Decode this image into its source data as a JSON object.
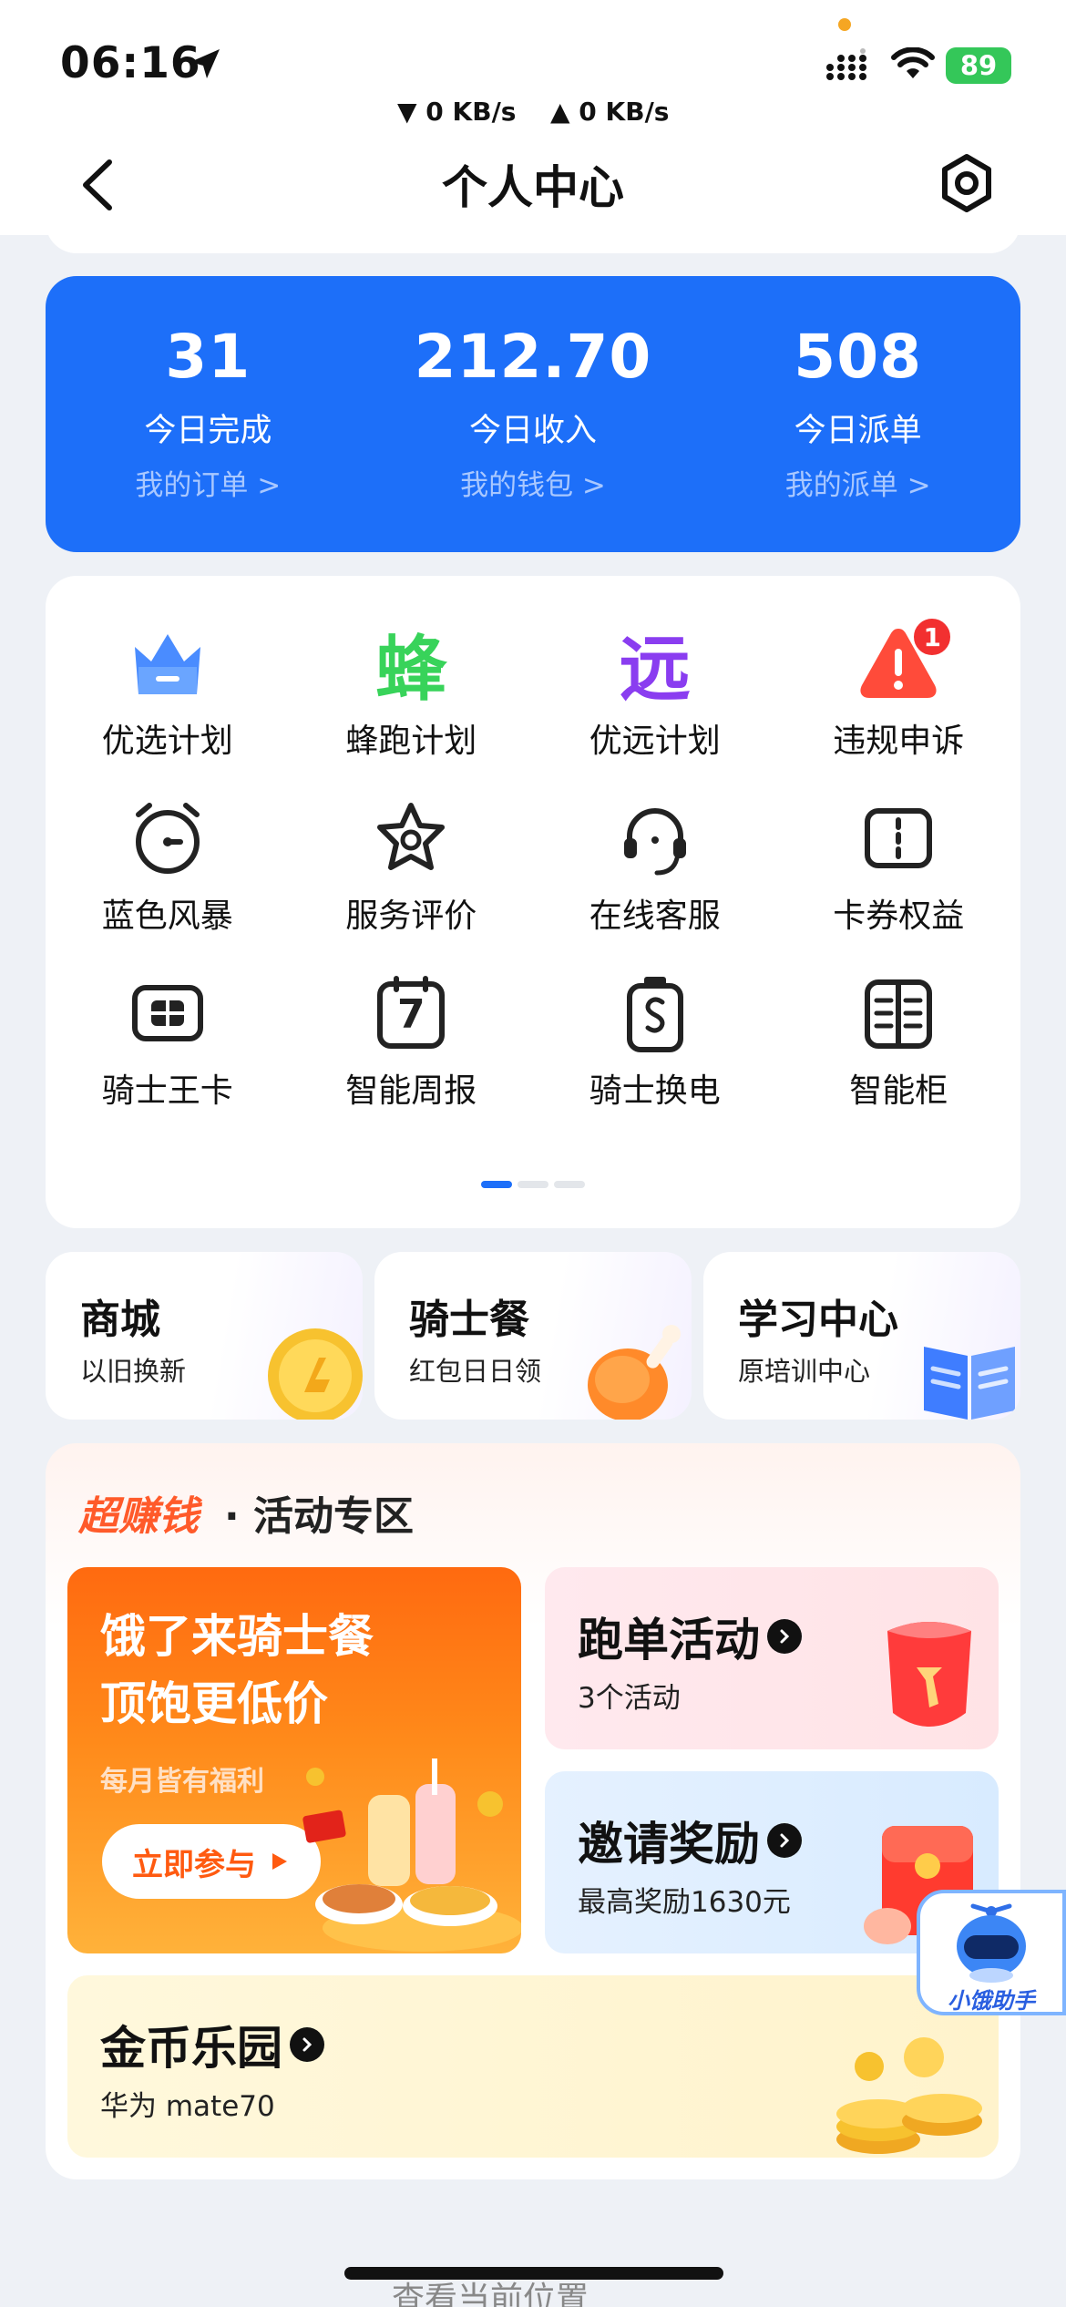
{
  "status_bar": {
    "time": "06:16",
    "battery": "89",
    "download": "0 KB/s",
    "upload": "0 KB/s",
    "download_arrow": "▼",
    "upload_arrow": "▲"
  },
  "header": {
    "title": "个人中心",
    "back_icon": "chevron-left-icon",
    "settings_icon": "gear-icon"
  },
  "stats": [
    {
      "value": "31",
      "label": "今日完成",
      "link": "我的订单 >"
    },
    {
      "value": "212.70",
      "label": "今日收入",
      "link": "我的钱包 >"
    },
    {
      "value": "508",
      "label": "今日派单",
      "link": "我的派单 >"
    }
  ],
  "services": [
    {
      "label": "优选计划",
      "icon": "crown-icon"
    },
    {
      "label": "蜂跑计划",
      "icon": "bee-run-icon",
      "glyph": "蜂"
    },
    {
      "label": "优远计划",
      "icon": "far-plan-icon",
      "glyph": "远"
    },
    {
      "label": "违规申诉",
      "icon": "alert-icon",
      "badge": "1"
    },
    {
      "label": "蓝色风暴",
      "icon": "alarm-clock-icon"
    },
    {
      "label": "服务评价",
      "icon": "star-badge-icon"
    },
    {
      "label": "在线客服",
      "icon": "headset-icon"
    },
    {
      "label": "卡券权益",
      "icon": "coupon-icon"
    },
    {
      "label": "骑士王卡",
      "icon": "card-icon"
    },
    {
      "label": "智能周报",
      "icon": "calendar-icon",
      "glyph": "7"
    },
    {
      "label": "骑士换电",
      "icon": "battery-swap-icon"
    },
    {
      "label": "智能柜",
      "icon": "cabinet-icon"
    }
  ],
  "pager": {
    "pages": 3,
    "active": 0
  },
  "shortcuts": [
    {
      "title": "商城",
      "subtitle": "以旧换新",
      "icon": "coin-icon"
    },
    {
      "title": "骑士餐",
      "subtitle": "红包日日领",
      "icon": "chicken-leg-icon"
    },
    {
      "title": "学习中心",
      "subtitle": "原培训中心",
      "icon": "book-icon"
    }
  ],
  "activity": {
    "brand": "超赚钱",
    "title": "· 活动专区",
    "promo": {
      "line1": "饿了来骑士餐",
      "line2": "顶饱更低价",
      "sub": "每月皆有福利",
      "button": "立即参与"
    },
    "run": {
      "title": "跑单活动",
      "subtitle": "3个活动"
    },
    "invite": {
      "title": "邀请奖励",
      "subtitle": "最高奖励1630元"
    },
    "coins": {
      "title": "金币乐园",
      "subtitle": "华为 mate70"
    }
  },
  "assistant": {
    "label": "小饿助手",
    "icon": "robot-helmet-icon"
  },
  "bottom": {
    "hint": "查看当前位置"
  }
}
